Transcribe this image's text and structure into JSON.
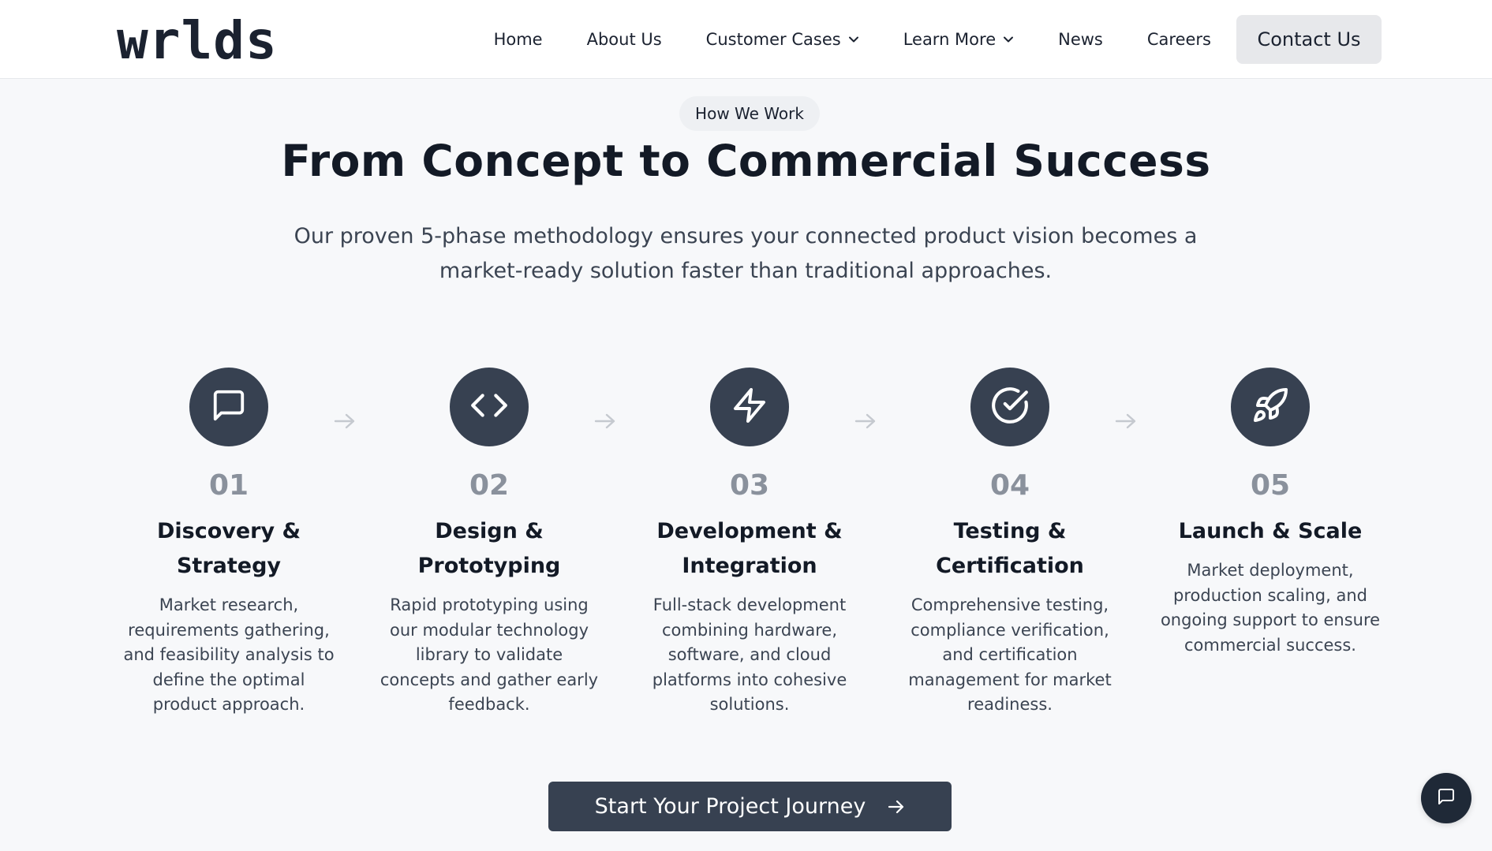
{
  "brand": {
    "logo_text": "wrlds"
  },
  "nav": {
    "items": [
      {
        "label": "Home",
        "dropdown": false
      },
      {
        "label": "About Us",
        "dropdown": false
      },
      {
        "label": "Customer Cases",
        "dropdown": true
      },
      {
        "label": "Learn More",
        "dropdown": true
      },
      {
        "label": "News",
        "dropdown": false
      },
      {
        "label": "Careers",
        "dropdown": false
      }
    ],
    "contact_label": "Contact Us"
  },
  "section": {
    "eyebrow": "How We Work",
    "title": "From Concept to Commercial Success",
    "subtitle": "Our proven 5-phase methodology ensures your connected product vision becomes a market-ready solution faster than traditional approaches."
  },
  "steps": [
    {
      "number": "01",
      "title": "Discovery & Strategy",
      "icon": "message-square-icon",
      "description": "Market research, requirements gathering, and feasibility analysis to define the optimal product approach."
    },
    {
      "number": "02",
      "title": "Design & Prototyping",
      "icon": "code-icon",
      "description": "Rapid prototyping using our modular technology library to validate concepts and gather early feedback."
    },
    {
      "number": "03",
      "title": "Development & Integration",
      "icon": "lightning-bolt-icon",
      "description": "Full-stack development combining hardware, software, and cloud platforms into cohesive solutions."
    },
    {
      "number": "04",
      "title": "Testing & Certification",
      "icon": "check-circle-icon",
      "description": "Comprehensive testing, compliance verification, and certification management for market readiness."
    },
    {
      "number": "05",
      "title": "Launch & Scale",
      "icon": "rocket-icon",
      "description": "Market deployment, production scaling, and ongoing support to ensure commercial success."
    }
  ],
  "cta": {
    "label": "Start Your Project Journey"
  },
  "chat": {
    "icon": "chat-bubble-icon"
  },
  "colors": {
    "primary_dark": "#374151",
    "background": "#f7f8fa",
    "step_number": "#8a919c",
    "arrow": "#c5c9cf"
  }
}
